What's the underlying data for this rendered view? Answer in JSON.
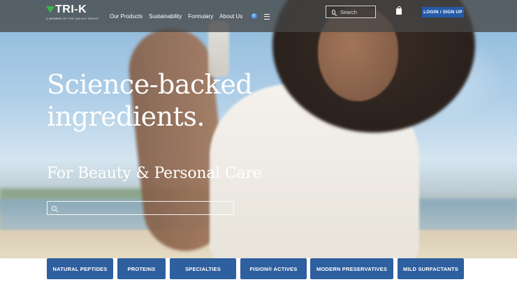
{
  "brand": {
    "logo_text": "TRI-K",
    "tagline": "A MEMBER OF THE GALAXY GROUP",
    "accent_color": "#39b54a"
  },
  "nav": {
    "links": [
      "Our Products",
      "Sustainability",
      "Formulary",
      "About Us"
    ],
    "icons": [
      "globe-icon",
      "menu-icon"
    ]
  },
  "header": {
    "search_placeholder": "Search",
    "cart_icon": "shopping-bag-icon",
    "login_label": "LOGIN / SIGN UP",
    "login_color": "#245aa8"
  },
  "hero": {
    "headline_line1": "Science-backed",
    "headline_line2": "ingredients.",
    "subheadline": "For Beauty & Personal Care",
    "search_value": ""
  },
  "categories": {
    "button_color": "#2e5f9e",
    "items": [
      "NATURAL PEPTIDES",
      "PROTEINS",
      "SPECIALTIES",
      "FISION® ACTIVES",
      "MODERN PRESERVATIVES",
      "MILD SURFACTANTS"
    ]
  }
}
